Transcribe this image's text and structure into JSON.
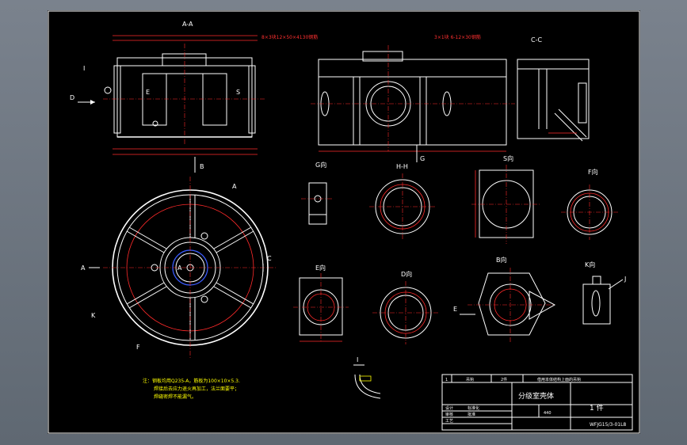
{
  "views": {
    "aa": "A-A",
    "cc": "C-C",
    "g": "G向",
    "hh": "H-H",
    "s": "S向",
    "f": "F向",
    "e": "E向",
    "d": "D向",
    "b": "B向",
    "k": "K向",
    "i": "I"
  },
  "markers": {
    "A": "A",
    "B": "B",
    "C": "C",
    "D": "D",
    "E": "E",
    "F": "F",
    "G": "G",
    "I": "I",
    "J": "J",
    "K": "K",
    "S": "S"
  },
  "callouts": {
    "bolts_1": "8×3块12×50×4130钢筋",
    "bolts_2": "3×1块 6-12×30钢筋",
    "note_1": "注：钢板均用Q235-A，筋板为100×10×5.3.",
    "note_2": "焊接后去应力退火再加工，法兰面要平；",
    "note_3": "焊缝密焊不能漏气。"
  },
  "title_block": {
    "row_top": {
      "c1": "1",
      "c2": "吊钩",
      "c3": "2件",
      "c4": "借用本体结构上面的吊钩"
    },
    "name": "分级室壳体",
    "qty": "1 件",
    "weight": "440",
    "drawing_no": "WFJG15/3-01L8",
    "labels": [
      "设计",
      "审核",
      "工艺",
      "标准化",
      "批准"
    ]
  }
}
